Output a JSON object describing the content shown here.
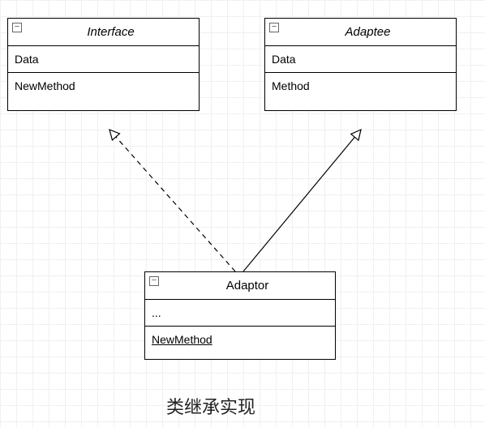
{
  "classes": {
    "interface": {
      "name": "Interface",
      "attr": "Data",
      "method": "NewMethod"
    },
    "adaptee": {
      "name": "Adaptee",
      "attr": "Data",
      "method": "Method"
    },
    "adaptor": {
      "name": "Adaptor",
      "attr": "...",
      "method": "NewMethod"
    }
  },
  "caption": "类继承实现",
  "icons": {
    "collapse": "−"
  }
}
